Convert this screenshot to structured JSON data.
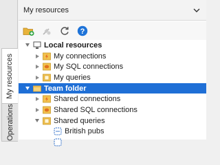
{
  "side_tabs": {
    "my_resources": "My resources",
    "operations": "Operations"
  },
  "panel": {
    "title": "My resources"
  },
  "toolbar": {
    "buttons": [
      "new-folder-icon",
      "connect-icon",
      "refresh-icon",
      "help-icon"
    ]
  },
  "tree": {
    "local_resources": "Local resources",
    "my_connections": "My connections",
    "my_sql_connections": "My SQL connections",
    "my_queries": "My queries",
    "team_folder": "Team folder",
    "shared_connections": "Shared connections",
    "shared_sql_connections": "Shared SQL connections",
    "shared_queries": "Shared queries",
    "british_pubs": "British pubs"
  },
  "colors": {
    "selection": "#1f6fd6",
    "folder": "#f2c14e",
    "help": "#1e73d8",
    "connection": "#f08a24"
  }
}
